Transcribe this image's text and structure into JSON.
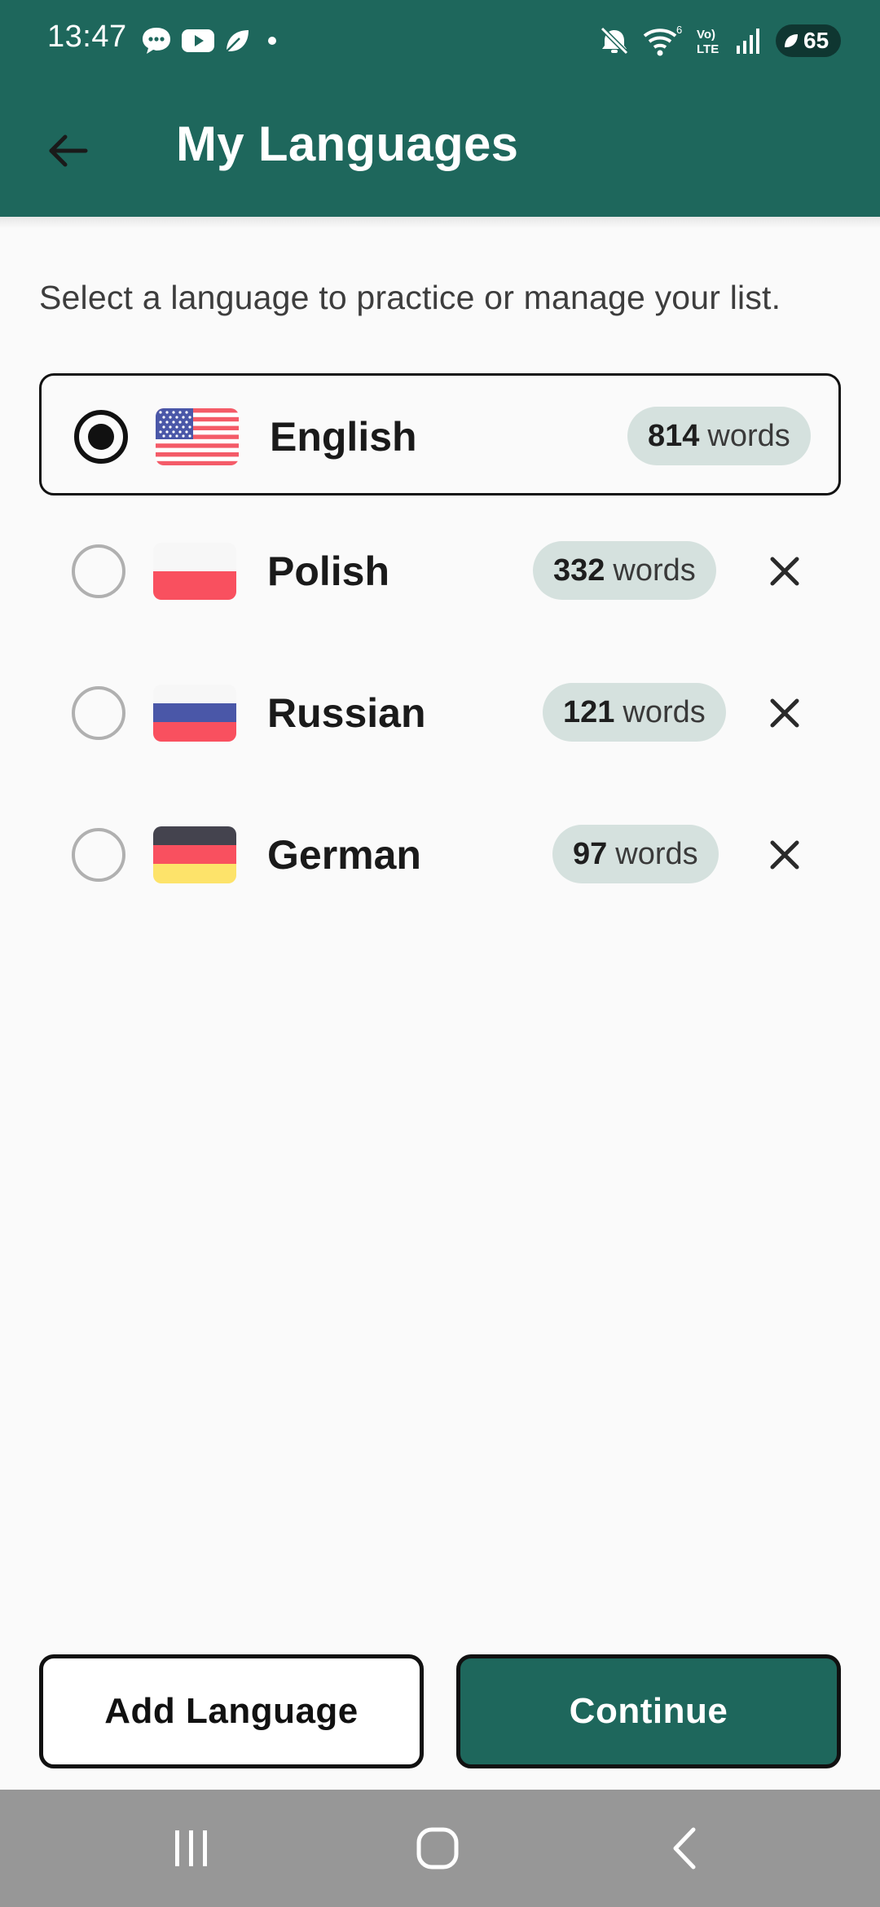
{
  "status_bar": {
    "time": "13:47",
    "notification_icons": [
      "chat-bubble-icon",
      "youtube-icon",
      "leaf-icon",
      "dot-icon"
    ],
    "system_icons": [
      "mute-icon",
      "wifi-icon",
      "volte-icon",
      "signal-icon"
    ],
    "battery": "65"
  },
  "app_bar": {
    "title": "My Languages",
    "back_icon": "arrow-left-icon"
  },
  "subtitle": "Select a language to practice or manage your list.",
  "languages": [
    {
      "name": "English",
      "count": "814",
      "unit": "words",
      "selected": true,
      "flag": "us-flag-icon",
      "removable": false
    },
    {
      "name": "Polish",
      "count": "332",
      "unit": "words",
      "selected": false,
      "flag": "poland-flag-icon",
      "removable": true
    },
    {
      "name": "Russian",
      "count": "121",
      "unit": "words",
      "selected": false,
      "flag": "russia-flag-icon",
      "removable": true
    },
    {
      "name": "German",
      "count": "97",
      "unit": "words",
      "selected": false,
      "flag": "germany-flag-icon",
      "removable": true
    }
  ],
  "buttons": {
    "add_language": "Add Language",
    "continue": "Continue"
  },
  "nav_bar": {
    "icons": [
      "recents-icon",
      "home-icon",
      "back-icon"
    ]
  },
  "colors": {
    "primary": "#1e675c",
    "pill_background": "#d5e1de",
    "page_background": "#fafafa",
    "nav_bar": "#979797",
    "flag_red": "#f9505f"
  }
}
